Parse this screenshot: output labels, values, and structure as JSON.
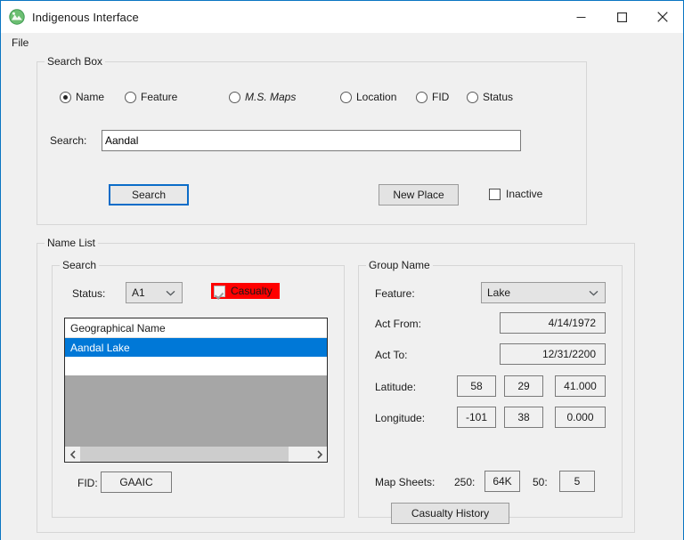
{
  "window": {
    "title": "Indigenous Interface",
    "app_icon": "globe-mountain-icon",
    "controls": {
      "minimize": "minimize-icon",
      "maximize": "maximize-icon",
      "close": "close-icon"
    }
  },
  "menubar": {
    "items": [
      {
        "label": "File"
      }
    ]
  },
  "search_box": {
    "legend": "Search Box",
    "radios": [
      {
        "label": "Name",
        "selected": true,
        "italic": false
      },
      {
        "label": "Feature",
        "selected": false,
        "italic": false
      },
      {
        "label": "M.S. Maps",
        "selected": false,
        "italic": true
      },
      {
        "label": "Location",
        "selected": false,
        "italic": false
      },
      {
        "label": "FID",
        "selected": false,
        "italic": false
      },
      {
        "label": "Status",
        "selected": false,
        "italic": false
      }
    ],
    "search_label": "Search:",
    "search_value": "Aandal",
    "search_placeholder": "",
    "search_button": "Search",
    "new_place_button": "New Place",
    "inactive_checkbox": {
      "label": "Inactive",
      "checked": false
    }
  },
  "name_list": {
    "legend": "Name List",
    "search_group": {
      "legend": "Search",
      "status_label": "Status:",
      "status_value": "A1",
      "status_options": [
        "A1"
      ],
      "casualty_checkbox": {
        "label": "Casualty",
        "checked": true,
        "highlight_color": "#ff0000"
      }
    },
    "list": {
      "header": "Geographical Name",
      "rows": [
        {
          "text": "Aandal Lake",
          "selected": true
        },
        {
          "text": "",
          "selected": false
        }
      ],
      "scrollbar": {
        "left_arrow": "chevron-left-icon",
        "right_arrow": "chevron-right-icon"
      }
    },
    "fid_label": "FID:",
    "fid_value": "GAAIC"
  },
  "group_name": {
    "legend": "Group Name",
    "feature_label": "Feature:",
    "feature_value": "Lake",
    "feature_options": [
      "Lake"
    ],
    "act_from_label": "Act From:",
    "act_from_value": "4/14/1972",
    "act_to_label": "Act To:",
    "act_to_value": "12/31/2200",
    "latitude_label": "Latitude:",
    "latitude": {
      "degrees": "58",
      "minutes": "29",
      "seconds": "41.000"
    },
    "longitude_label": "Longitude:",
    "longitude": {
      "degrees": "-101",
      "minutes": "38",
      "seconds": "0.000"
    },
    "map_sheets_label": "Map Sheets:",
    "map_250_label": "250:",
    "map_250_value": "64K",
    "map_50_label": "50:",
    "map_50_value": "5",
    "casualty_history_button": "Casualty History"
  },
  "colors": {
    "window_border": "#0a75c2",
    "face": "#f0f0f0",
    "selection": "#0078d7",
    "casualty_red": "#ff0000",
    "focus_blue": "#0a6cc8"
  }
}
